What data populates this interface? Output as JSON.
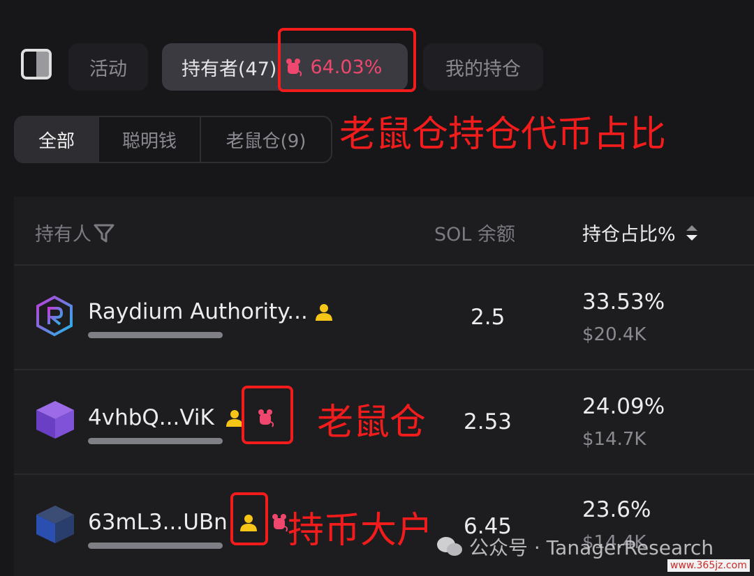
{
  "tabs": {
    "activity": "活动",
    "holders": "持有者(47)",
    "rat_pct": "64.03%",
    "my_position": "我的持仓"
  },
  "filters": {
    "all": "全部",
    "smart_money": "聪明钱",
    "rat_traders": "老鼠仓(9)"
  },
  "table": {
    "headers": {
      "holder": "持有人",
      "sol_balance": "SOL 余额",
      "hold_pct": "持仓占比%"
    },
    "rows": [
      {
        "name": "Raydium Authority...",
        "sol": "2.5",
        "pct": "33.53%",
        "usd": "$20.4K"
      },
      {
        "name": "4vhbQ...ViK",
        "sol": "2.53",
        "pct": "24.09%",
        "usd": "$14.7K"
      },
      {
        "name": "63mL3...UBn",
        "sol": "6.45",
        "pct": "23.6%",
        "usd": "$14.4K"
      }
    ]
  },
  "annotations": {
    "rat_ratio": "老鼠仓持仓代币占比",
    "rat": "老鼠仓",
    "whale": "持币大户"
  },
  "watermark": {
    "text": "公众号 · TanagerResearch",
    "site": "www.365jz.com"
  },
  "colors": {
    "accent_pink": "#f0476f",
    "badge_yellow": "#f5c518",
    "annotation_red": "#f21c1c"
  }
}
